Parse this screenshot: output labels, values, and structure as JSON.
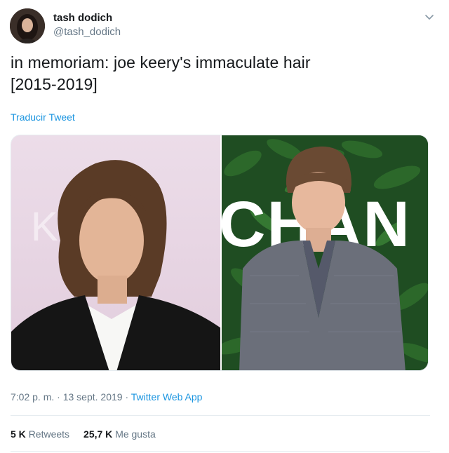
{
  "user": {
    "display_name": "tash dodich",
    "handle": "@tash_dodich"
  },
  "tweet": {
    "text_line1": "in memoriam: joe keery's immaculate hair",
    "text_line2": "[2015-2019]",
    "translate_label": "Traducir Tweet"
  },
  "media": {
    "left_photo_backdrop_text": "K R M",
    "right_photo_backdrop_text": "CHAN"
  },
  "meta": {
    "time": "7:02 p. m.",
    "separator1": "·",
    "date": "13 sept. 2019",
    "separator2": "·",
    "source": "Twitter Web App"
  },
  "stats": {
    "retweets_count": "5 K",
    "retweets_label": "Retweets",
    "likes_count": "25,7 K",
    "likes_label": "Me gusta"
  },
  "colors": {
    "link": "#1b95e0",
    "secondary_text": "#657786",
    "primary_text": "#14171a"
  },
  "icons": {
    "menu": "chevron-down-icon"
  }
}
